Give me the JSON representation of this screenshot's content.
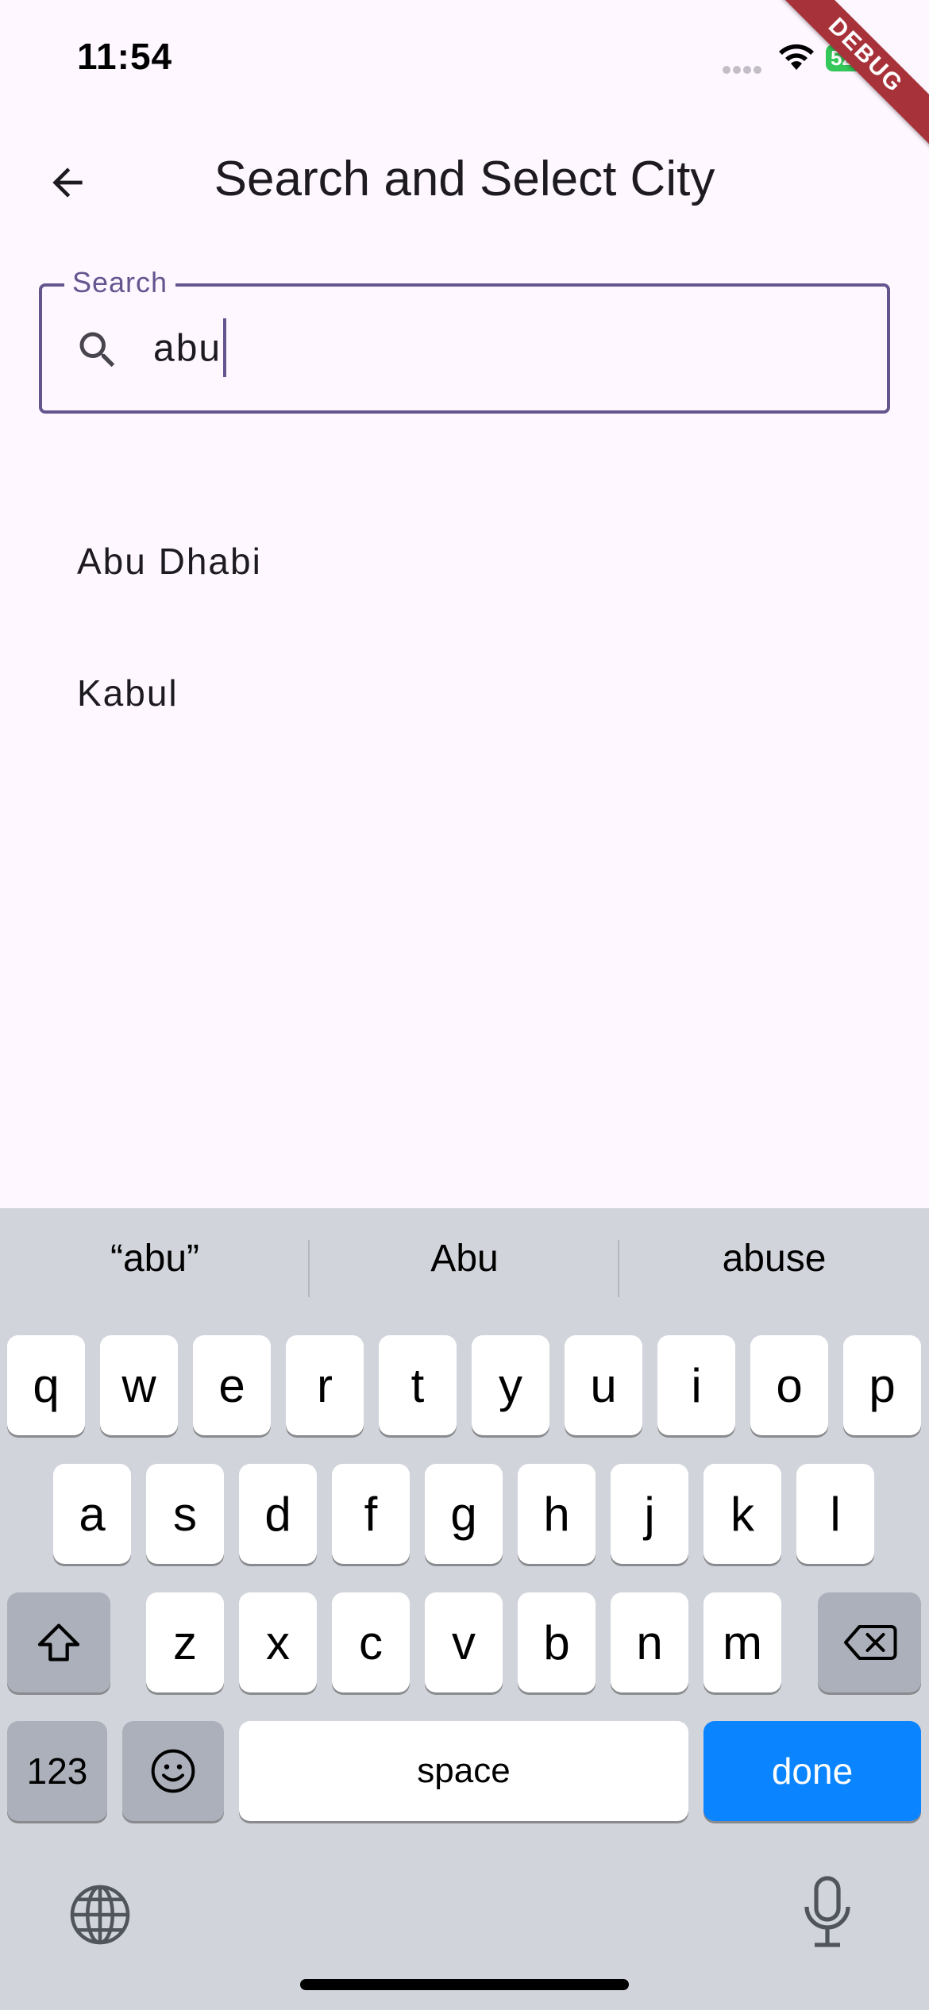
{
  "status_bar": {
    "time": "11:54",
    "battery": "52"
  },
  "debug_banner": "DEBUG",
  "app_bar": {
    "title": "Search and Select City"
  },
  "search": {
    "label": "Search",
    "value": "abu"
  },
  "results": [
    {
      "label": "Abu Dhabi"
    },
    {
      "label": "Kabul"
    }
  ],
  "keyboard": {
    "suggestions": [
      "“abu”",
      "Abu",
      "abuse"
    ],
    "row1": [
      "q",
      "w",
      "e",
      "r",
      "t",
      "y",
      "u",
      "i",
      "o",
      "p"
    ],
    "row2": [
      "a",
      "s",
      "d",
      "f",
      "g",
      "h",
      "j",
      "k",
      "l"
    ],
    "row3": [
      "z",
      "x",
      "c",
      "v",
      "b",
      "n",
      "m"
    ],
    "numbers_label": "123",
    "space_label": "space",
    "done_label": "done",
    "done_color": "#0A84FF"
  },
  "accent_color": "#65558F",
  "icons": [
    "arrow-back-icon",
    "search-icon",
    "shift-icon",
    "backspace-icon",
    "emoji-icon",
    "globe-icon",
    "microphone-icon",
    "wifi-icon",
    "battery-icon"
  ]
}
